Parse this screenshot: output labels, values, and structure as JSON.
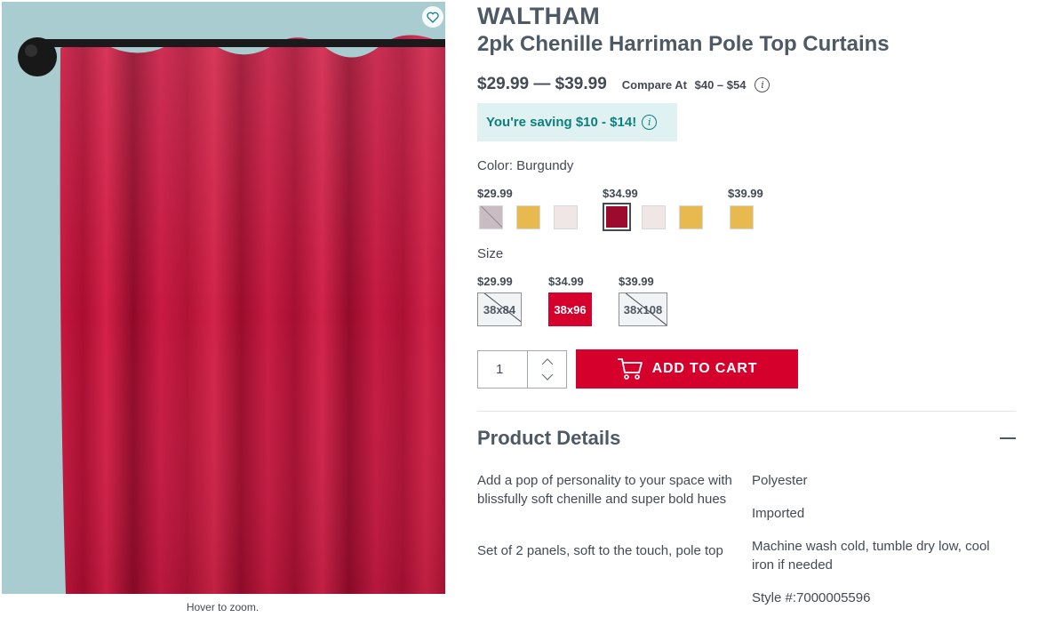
{
  "image": {
    "hover_hint": "Hover to zoom."
  },
  "product": {
    "brand": "WALTHAM",
    "title": "2pk Chenille Harriman Pole Top Curtains",
    "price_range": "$29.99 — $39.99",
    "compare_label": "Compare At",
    "compare_value": "$40 – $54",
    "saving": "You're saving $10 - $14!"
  },
  "color": {
    "label": "Color: Burgundy",
    "tier_prices": [
      "$29.99",
      "$34.99",
      "$39.99"
    ],
    "swatches": [
      {
        "name": "mauve",
        "color": "#c9bcc3",
        "available": false
      },
      {
        "name": "gold",
        "color": "#e8b94e",
        "available": true
      },
      {
        "name": "blush",
        "color": "#f1e6e6",
        "available": true
      },
      {
        "name": "burgundy",
        "color": "#9c0a2d",
        "available": true,
        "selected": true
      },
      {
        "name": "blush",
        "color": "#f1e6e6",
        "available": true
      },
      {
        "name": "gold",
        "color": "#e8b94e",
        "available": true
      },
      {
        "name": "gold",
        "color": "#e8b94e",
        "available": true
      }
    ]
  },
  "size": {
    "label": "Size",
    "tier_prices": [
      "$29.99",
      "$34.99",
      "$39.99"
    ],
    "options": [
      {
        "label": "38x84",
        "available": false
      },
      {
        "label": "38x96",
        "available": true,
        "selected": true
      },
      {
        "label": "38x108",
        "available": false
      }
    ]
  },
  "cart": {
    "quantity": "1",
    "add_label": "ADD TO CART"
  },
  "details": {
    "heading": "Product Details",
    "left": [
      "Add a pop of personality to your space with blissfully soft chenille and super bold hues",
      "Set of 2 panels, soft to the touch, pole top"
    ],
    "right": [
      "Polyester",
      "Imported",
      "Machine wash cold, tumble dry low, cool iron if needed",
      "Style #:7000005596"
    ]
  },
  "colors": {
    "accent": "#d5002b",
    "saving_bg": "#dff2f1",
    "saving_text": "#0d7f7f",
    "text": "#434a54"
  }
}
